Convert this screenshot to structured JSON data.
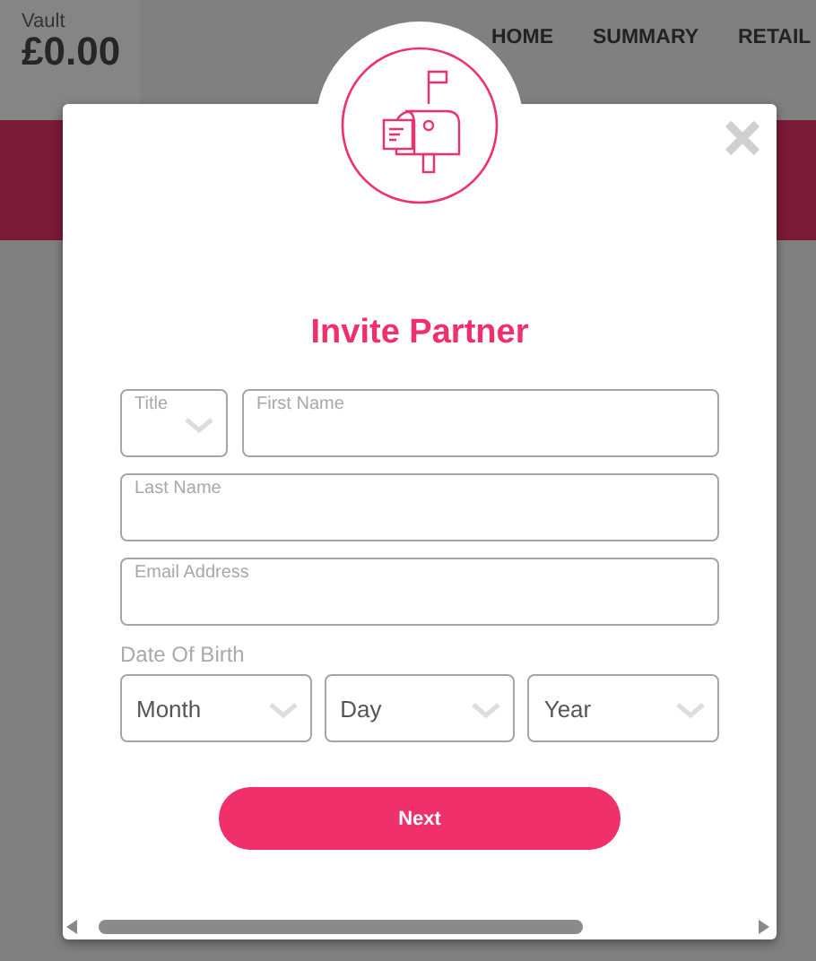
{
  "header": {
    "vault_label": "Vault",
    "balance": "£0.00",
    "nav": [
      {
        "label": "HOME"
      },
      {
        "label": "SUMMARY"
      },
      {
        "label": "RETAIL"
      }
    ]
  },
  "modal": {
    "title": "Invite Partner",
    "name_fields": [
      {
        "kind": "select",
        "label": "Title"
      },
      {
        "kind": "text",
        "label": "First Name"
      }
    ],
    "fields": [
      {
        "label": "Last Name"
      },
      {
        "label": "Email Address"
      }
    ],
    "dob_label": "Date Of Birth",
    "dob_selects": [
      {
        "value": "Month"
      },
      {
        "value": "Day"
      },
      {
        "value": "Year"
      }
    ],
    "button": "Next"
  }
}
